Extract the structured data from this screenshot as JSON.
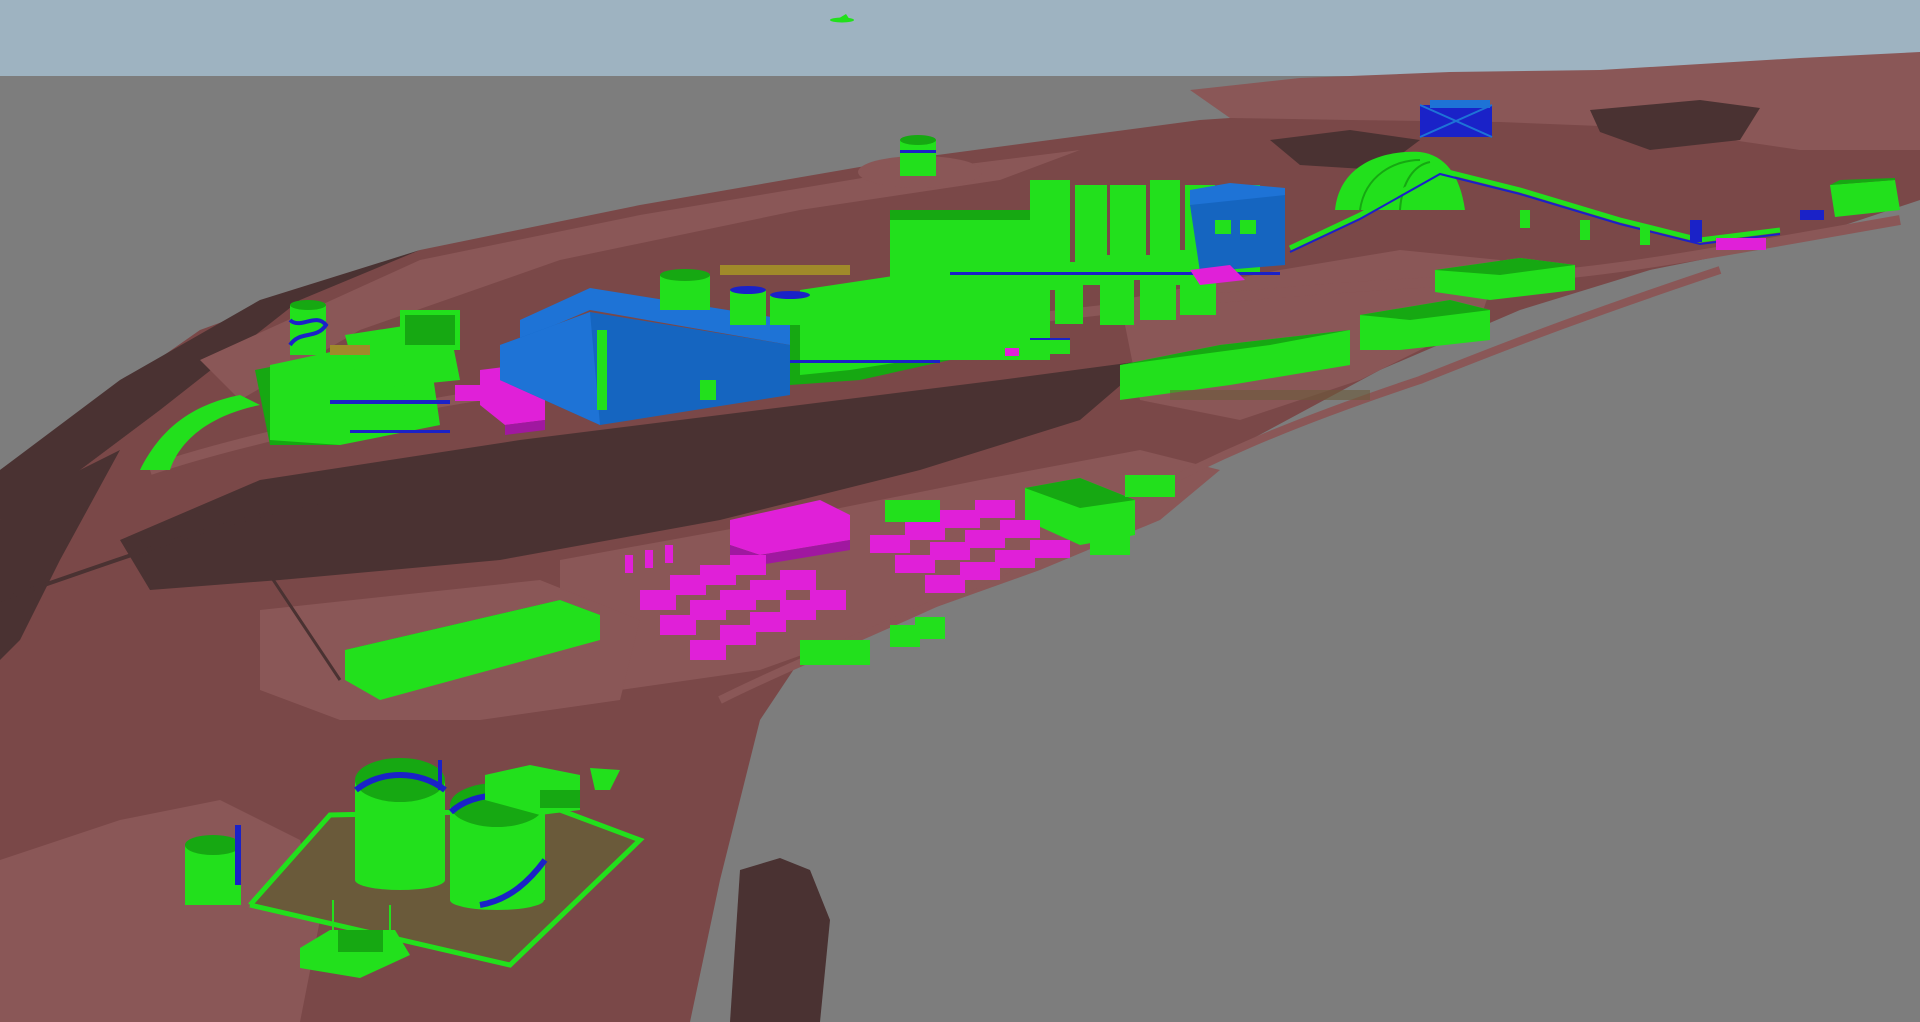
{
  "viewport": {
    "kind": "3d-plant-model-view"
  },
  "colors": {
    "sky": "#9eb3c1",
    "ground": "#7d7d7d",
    "terrain": "#7a4848",
    "terrain_dark": "#4a3232",
    "terrain_light": "#8a5757",
    "structure": "#22e01c",
    "structure_shade": "#16a812",
    "steel": "#1a22c8",
    "building": "#1565c0",
    "building_roof": "#1e73d6",
    "equipment": "#e020d8",
    "equipment_shade": "#a018a0",
    "pad": "#6a5a3a",
    "gold": "#a08a2a"
  },
  "icons": {
    "aircraft": "aircraft-icon"
  }
}
